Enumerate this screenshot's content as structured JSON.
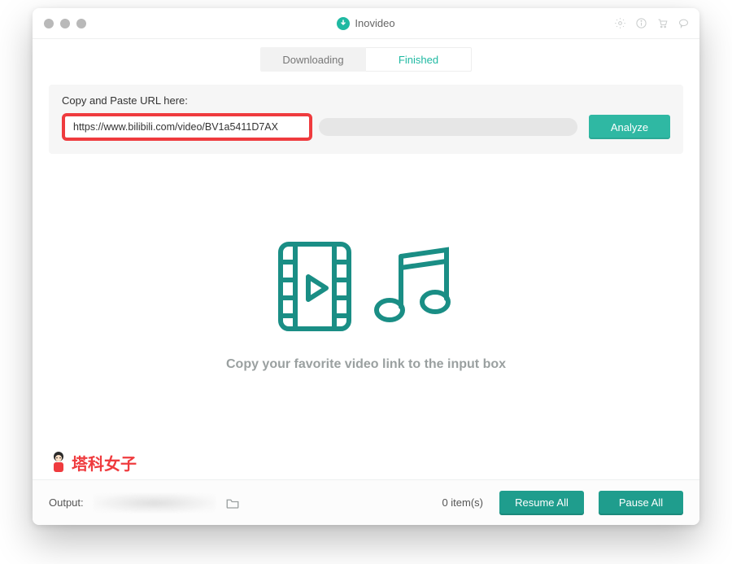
{
  "app": {
    "name": "Inovideo"
  },
  "titlebar_icons": [
    "gear-icon",
    "info-icon",
    "cart-icon",
    "chat-icon"
  ],
  "tabs": {
    "downloading": "Downloading",
    "finished": "Finished",
    "active": "finished"
  },
  "url_panel": {
    "label": "Copy and Paste URL here:",
    "value": "https://www.bilibili.com/video/BV1a5411D7AX",
    "analyze": "Analyze"
  },
  "main": {
    "hint": "Copy your favorite video link to the input box"
  },
  "watermark": {
    "text": "塔科女子"
  },
  "bottom": {
    "output_label": "Output:",
    "items": "0 item(s)",
    "resume": "Resume All",
    "pause": "Pause All"
  },
  "colors": {
    "accent": "#1fb9a2",
    "highlight": "#ef3b3e"
  }
}
